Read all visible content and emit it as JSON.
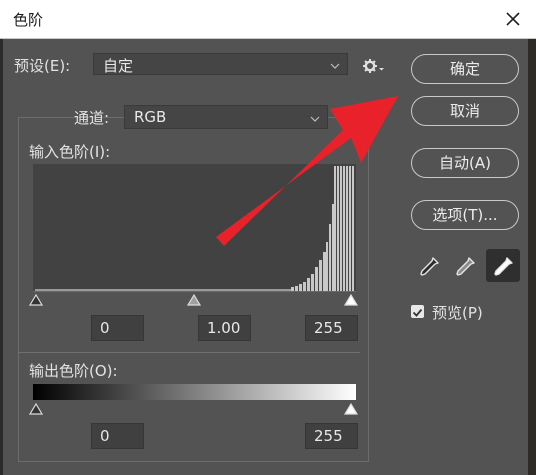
{
  "dialog": {
    "title": "色阶"
  },
  "preset": {
    "label": "预设(E):",
    "value": "自定"
  },
  "channel": {
    "label": "通道:",
    "value": "RGB"
  },
  "input_levels": {
    "label": "输入色阶(I):",
    "shadow": "0",
    "midtone": "1.00",
    "highlight": "255"
  },
  "output_levels": {
    "label": "输出色阶(O):",
    "shadow": "0",
    "highlight": "255"
  },
  "buttons": {
    "ok": "确定",
    "cancel": "取消",
    "auto": "自动(A)",
    "options": "选项(T)..."
  },
  "preview": {
    "label": "预览(P)",
    "checked": true
  },
  "icons": [
    "close-icon",
    "gear-icon",
    "chevron-down-icon",
    "black-point-eyedropper-icon",
    "gray-point-eyedropper-icon",
    "white-point-eyedropper-icon",
    "checkmark-icon"
  ],
  "colors": {
    "dialog_bg": "#535353",
    "title_bg": "#ffffff",
    "annotation_arrow": "#e8212a"
  }
}
